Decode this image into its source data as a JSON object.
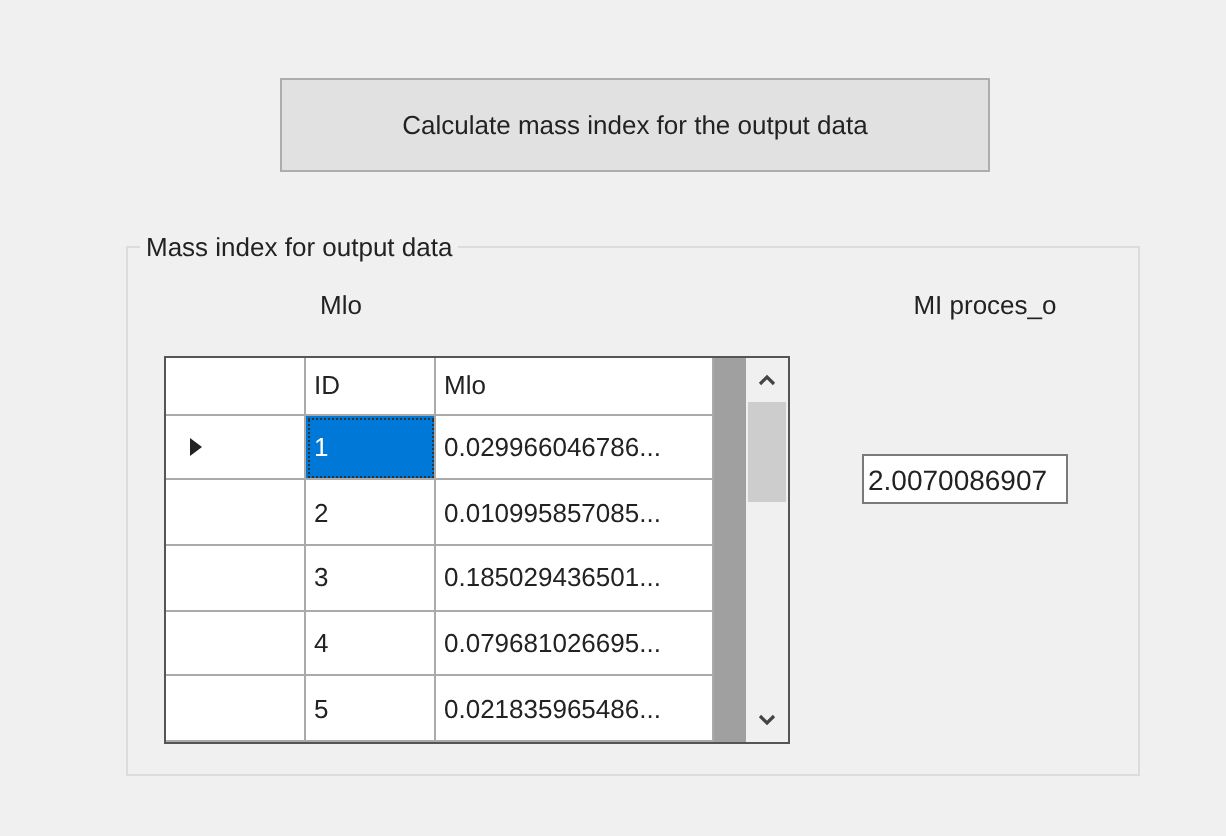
{
  "calculate_button": "Calculate mass index for the output data",
  "group": {
    "title": "Mass index for output data",
    "grid_label": "Mlo",
    "grid": {
      "columns": [
        "ID",
        "Mlo"
      ],
      "rows": [
        {
          "id": "1",
          "value": "0.029966046786...",
          "selected": true
        },
        {
          "id": "2",
          "value": "0.010995857085...",
          "selected": false
        },
        {
          "id": "3",
          "value": "0.185029436501...",
          "selected": false
        },
        {
          "id": "4",
          "value": "0.079681026695...",
          "selected": false
        },
        {
          "id": "5",
          "value": "0.021835965486...",
          "selected": false
        }
      ]
    },
    "result_label": "MI proces_o",
    "result_value": "2.0070086907"
  }
}
